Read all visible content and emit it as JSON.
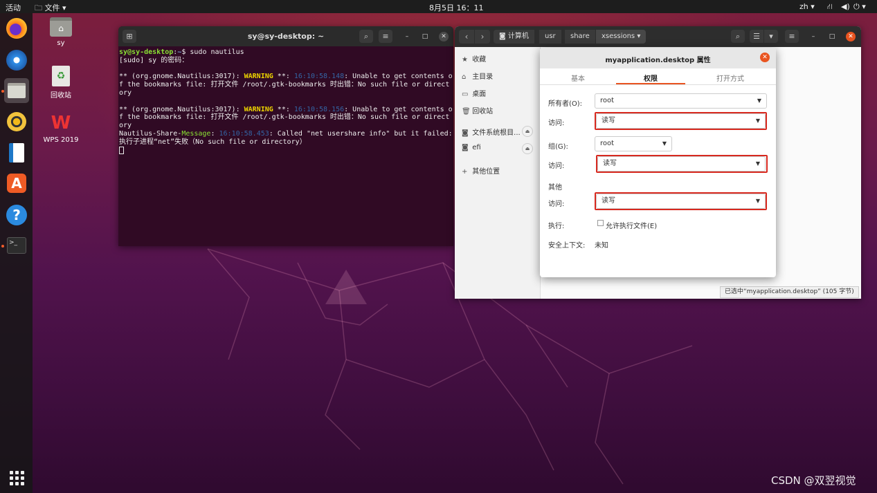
{
  "topbar": {
    "activities": "活动",
    "files_menu": "文件",
    "clock": "8月5日 16：11",
    "lang": "zh"
  },
  "desktop": {
    "icons": [
      {
        "label": "sy",
        "icon": "home-folder-icon"
      },
      {
        "label": "回收站",
        "icon": "trash-icon"
      },
      {
        "label": "WPS 2019",
        "icon": "wps-icon"
      }
    ]
  },
  "terminal": {
    "title": "sy@sy-desktop: ~",
    "lines": {
      "prompt_user": "sy@sy-desktop",
      "prompt_path": "~",
      "command": "$ sudo nautilus",
      "sudo": "[sudo] sy 的密码：",
      "w1_pre": "** (org.gnome.Nautilus:3017): ",
      "w1_level": "WARNING",
      "w1_mid": " **: ",
      "w1_time": "16:10:58.148",
      "w1_msg": ": Unable to get contents of the bookmarks file: 打开文件 /root/.gtk-bookmarks 时出错：No such file or directory",
      "w2_pre": "** (org.gnome.Nautilus:3017): ",
      "w2_level": "WARNING",
      "w2_mid": " **: ",
      "w2_time": "16:10:58.156",
      "w2_msg": ": Unable to get contents of the bookmarks file: 打开文件 /root/.gtk-bookmarks 时出错：No such file or directory",
      "m_pre": "Nautilus-Share-",
      "m_level": "Message",
      "m_time": "16:10:58.453",
      "m_msg": ": Called \"net usershare info\" but it failed: 执行子进程“net”失败（No such file or directory）"
    }
  },
  "files": {
    "breadcrumbs": [
      "计算机",
      "usr",
      "share",
      "xsessions"
    ],
    "sidebar": [
      {
        "label": "收藏",
        "icon": "star-icon"
      },
      {
        "label": "主目录",
        "icon": "home-icon"
      },
      {
        "label": "桌面",
        "icon": "desktop-icon"
      },
      {
        "label": "回收站",
        "icon": "trash-icon"
      },
      {
        "label": "文件系统根目...",
        "icon": "drive-icon"
      },
      {
        "label": "efi",
        "icon": "drive-icon"
      },
      {
        "label": "其他位置",
        "icon": "plus-icon"
      }
    ],
    "statusbar": "已选中“myapplication.desktop” (105 字节)"
  },
  "dialog": {
    "title": "myapplication.desktop 属性",
    "tabs": [
      "基本",
      "权限",
      "打开方式"
    ],
    "active_tab": "权限",
    "owner_label": "所有者(O):",
    "owner_value": "root",
    "owner_access_label": "访问:",
    "owner_access_value": "读写",
    "group_label": "组(G):",
    "group_value": "root",
    "group_access_label": "访问:",
    "group_access_value": "读写",
    "others_heading": "其他",
    "others_access_label": "访问:",
    "others_access_value": "读写",
    "exec_label": "执行:",
    "exec_checkbox": "允许执行文件(E)",
    "exec_checked": false,
    "context_label": "安全上下文:",
    "context_value": "未知"
  },
  "watermark": "CSDN @双翌视觉",
  "colors": {
    "accent": "#e95420",
    "highlight": "#d8291f",
    "terminal_bg": "#300a24"
  }
}
